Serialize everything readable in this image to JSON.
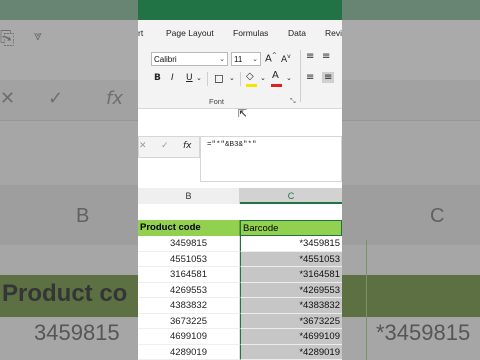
{
  "background": {
    "column_b_letter": "B",
    "column_c_letter": "C",
    "header_text": "Product co",
    "data_b": "3459815",
    "data_c": "*3459815"
  },
  "ribbon": {
    "tabs": [
      "rt",
      "Page Layout",
      "Formulas",
      "Data",
      "Revi"
    ],
    "font_name": "Calibri",
    "font_size": "11",
    "bold": "B",
    "italic": "I",
    "underline": "U",
    "grow_font": "A",
    "shrink_font": "A",
    "group_label": "Font",
    "accent_color": "#217346",
    "font_color": "#e02020",
    "fill_color": "#f5e600"
  },
  "formula_bar": {
    "cancel": "✕",
    "confirm": "✓",
    "fx": "fx",
    "formula": "=\"*\"&B3&\"*\""
  },
  "sheet": {
    "columns": [
      "B",
      "C"
    ],
    "header": {
      "b": "Product code",
      "c": "Barcode"
    },
    "rows": [
      {
        "b": "3459815",
        "c": "*3459815"
      },
      {
        "b": "4551053",
        "c": "*4551053"
      },
      {
        "b": "3164581",
        "c": "*3164581"
      },
      {
        "b": "4269553",
        "c": "*4269553"
      },
      {
        "b": "4383832",
        "c": "*4383832"
      },
      {
        "b": "3673225",
        "c": "*3673225"
      },
      {
        "b": "4699109",
        "c": "*4699109"
      },
      {
        "b": "4289019",
        "c": "*4289019"
      }
    ]
  }
}
